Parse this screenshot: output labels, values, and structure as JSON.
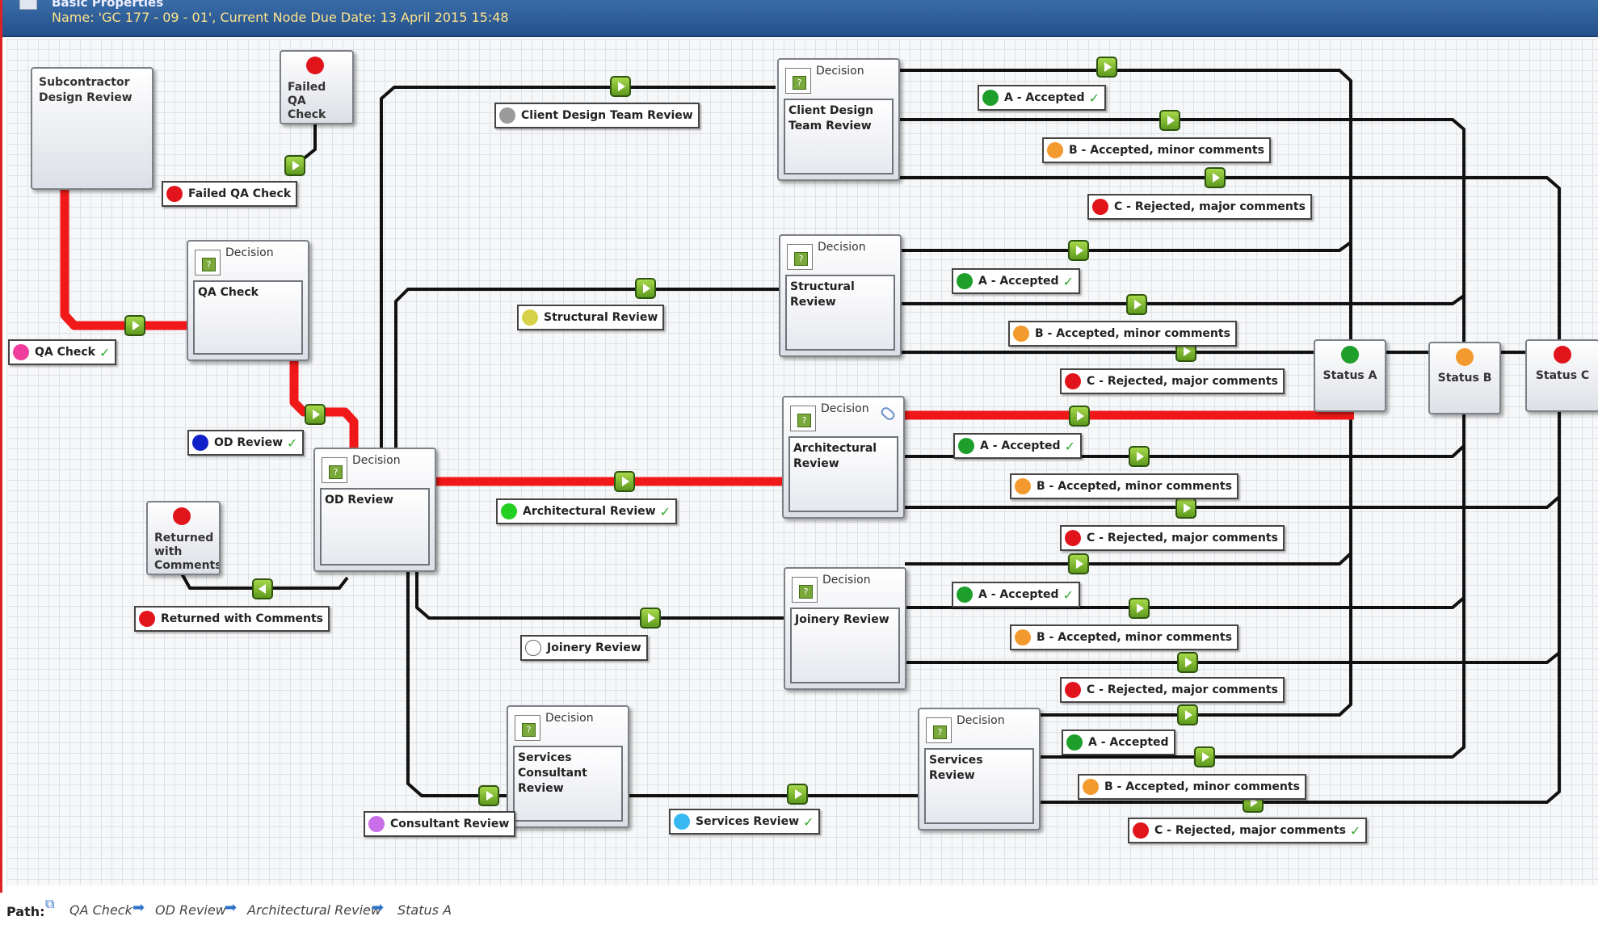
{
  "header": {
    "title": "Basic Properties",
    "subtitle": "Name: 'GC 177 - 09 - 01', Current Node Due Date: 13 April 2015 15:48"
  },
  "decision_label": "Decision",
  "nodes": {
    "subcontractor": "Subcontractor\nDesign Review",
    "failed_qa": "Failed\nQA\nCheck",
    "returned": "Returned\nwith\nComments",
    "qa_check": "QA Check",
    "od_review": "OD Review",
    "client_design": "Client Design\nTeam Review",
    "structural": "Structural Review",
    "architectural": "Architectural\nReview",
    "joinery": "Joinery Review",
    "services_consultant": "Services\nConsultant\nReview",
    "services": "Services Review"
  },
  "statuses": {
    "a": {
      "label": "Status A",
      "color": "#1e9e2a"
    },
    "b": {
      "label": "Status B",
      "color": "#f39a2e"
    },
    "c": {
      "label": "Status C",
      "color": "#e2141b"
    }
  },
  "tags": {
    "failed_qa_check": "Failed QA Check",
    "qa_check": "QA Check",
    "od_review": "OD Review",
    "returned_with_comments": "Returned with Comments",
    "client_design_team_review": "Client Design Team Review",
    "structural_review": "Structural Review",
    "architectural_review": "Architectural Review",
    "joinery_review": "Joinery Review",
    "consultant_review": "Consultant Review",
    "services_review": "Services Review",
    "a_accepted": "A - Accepted",
    "b_accepted": "B - Accepted, minor comments",
    "c_rejected": "C - Rejected, major comments"
  },
  "colors": {
    "red": "#e2141b",
    "green": "#1e9e2a",
    "orange": "#f39a2e",
    "pink": "#f03c9c",
    "blue": "#1020c8",
    "gray": "#9a9a9a",
    "yellow": "#d8d24a",
    "lime": "#22d022",
    "white": "#ffffff",
    "purple": "#c86ee8",
    "cyan": "#38b8f0",
    "active_path": "#f01818",
    "wire": "#111111"
  },
  "path_bar": {
    "label": "Path:",
    "items": [
      "QA Check",
      "OD Review",
      "Architectural Review",
      "Status A"
    ]
  }
}
